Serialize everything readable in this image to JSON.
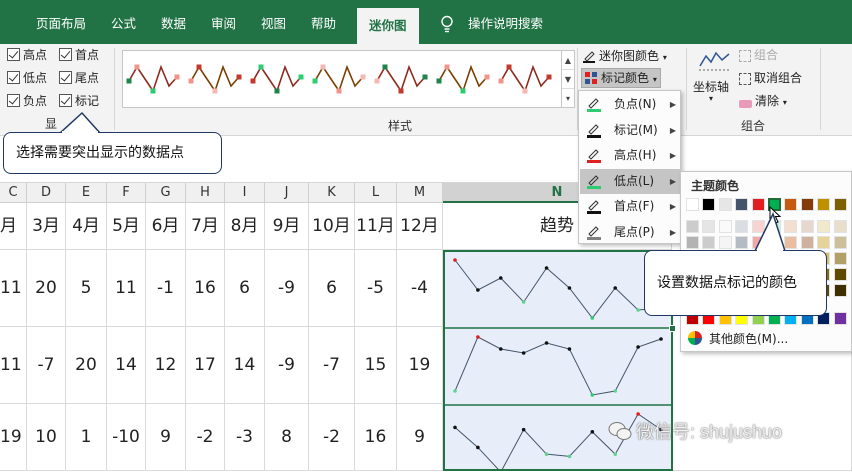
{
  "tabs": [
    {
      "label": "页面布局",
      "active": false
    },
    {
      "label": "公式",
      "active": false
    },
    {
      "label": "数据",
      "active": false
    },
    {
      "label": "审阅",
      "active": false
    },
    {
      "label": "视图",
      "active": false
    },
    {
      "label": "帮助",
      "active": false
    },
    {
      "label": "迷你图",
      "active": true
    }
  ],
  "tell_me": "操作说明搜索",
  "show": {
    "high": "高点",
    "first": "首点",
    "low": "低点",
    "last": "尾点",
    "negative": "负点",
    "markers": "标记",
    "group_label": "显"
  },
  "style_group_label": "样式",
  "sparkline_color": "迷你图颜色",
  "marker_color": "标记颜色",
  "axis": "坐标轴",
  "group_btn": "组合",
  "ungroup_btn": "取消组合",
  "clear_btn": "清除",
  "group_group_label": "组合",
  "marker_menu": [
    {
      "label": "负点(N)",
      "color": "#2ecc71"
    },
    {
      "label": "标记(M)",
      "color": "#111111"
    },
    {
      "label": "高点(H)",
      "color": "#e02020"
    },
    {
      "label": "低点(L)",
      "color": "#2ecc71"
    },
    {
      "label": "首点(F)",
      "color": "#111111"
    },
    {
      "label": "尾点(P)",
      "color": "#808080"
    }
  ],
  "palette": {
    "title": "主题颜色",
    "more": "其他颜色(M)...",
    "theme_row": [
      "#ffffff",
      "#000000",
      "#e7e6e6",
      "#44546a",
      "#e02020",
      "#00b050",
      "#c55a11",
      "#843c0c",
      "#bf9000",
      "#7f6000"
    ]
  },
  "columns": [
    "C",
    "D",
    "E",
    "F",
    "G",
    "H",
    "I",
    "J",
    "K",
    "L",
    "M",
    "N"
  ],
  "selected_column": "N",
  "months": [
    "月",
    "3月",
    "4月",
    "5月",
    "6月",
    "7月",
    "8月",
    "9月",
    "10月",
    "11月",
    "12月"
  ],
  "trend_header": "趋势",
  "rows": [
    [
      "11",
      "20",
      "5",
      "11",
      "-1",
      "16",
      "6",
      "-9",
      "6",
      "-5",
      "-4"
    ],
    [
      "11",
      "-7",
      "20",
      "14",
      "12",
      "17",
      "14",
      "-9",
      "-7",
      "15",
      "19"
    ],
    [
      "19",
      "10",
      "1",
      "-10",
      "9",
      "-2",
      "-3",
      "8",
      "-2",
      "16",
      "9"
    ]
  ],
  "callout1": "选择需要突出显示的数据点",
  "callout2": "设置数据点标记的颜色",
  "watermark": "微信号: shujushuo"
}
